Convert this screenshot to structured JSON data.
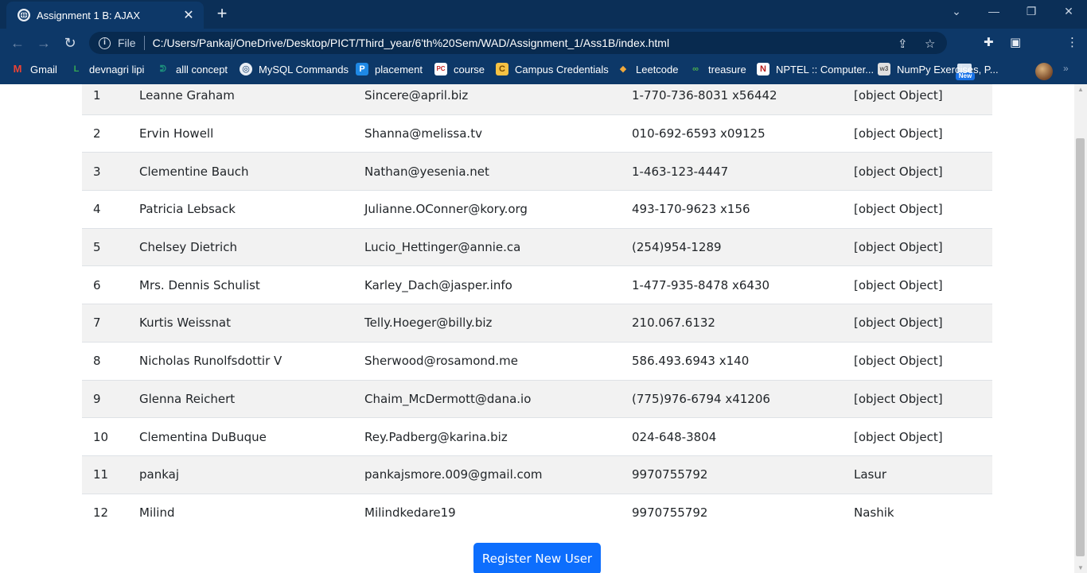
{
  "browser": {
    "tab_title": "Assignment 1 B: AJAX",
    "scheme_label": "File",
    "url": "C:/Users/Pankaj/OneDrive/Desktop/PICT/Third_year/6'th%20Sem/WAD/Assignment_1/Ass1B/index.html",
    "new_badge": "New",
    "bookmarks": [
      {
        "label": "Gmail",
        "icon": "gmail-icon",
        "color": "#ea4335",
        "glyph": "M"
      },
      {
        "label": "devnagri lipi",
        "icon": "bookmark-icon",
        "color": "#34a853",
        "glyph": "L"
      },
      {
        "label": "alll concept",
        "icon": "bookmark-icon",
        "color": "#1c8f7c",
        "glyph": "A"
      },
      {
        "label": "MySQL Commands",
        "icon": "globe-icon",
        "color": "#e9eef5",
        "glyph": "◎"
      },
      {
        "label": "placement",
        "icon": "bookmark-icon",
        "color": "#1e88e5",
        "glyph": "P"
      },
      {
        "label": "course",
        "icon": "bookmark-icon",
        "color": "#c62828",
        "glyph": "PC"
      },
      {
        "label": "Campus Credentials",
        "icon": "bookmark-icon",
        "color": "#f6c244",
        "glyph": "C"
      },
      {
        "label": "Leetcode",
        "icon": "leetcode-icon",
        "color": "#f0a93c",
        "glyph": "◆"
      },
      {
        "label": "treasure",
        "icon": "bookmark-icon",
        "color": "#4caf50",
        "glyph": "∞"
      },
      {
        "label": "NPTEL :: Computer...",
        "icon": "bookmark-icon",
        "color": "#b71c1c",
        "glyph": "N"
      },
      {
        "label": "NumPy Exercises, P...",
        "icon": "bookmark-icon",
        "color": "#8d8d8d",
        "glyph": "w3"
      }
    ]
  },
  "users": [
    {
      "id": "1",
      "name": "Leanne Graham",
      "email": "Sincere@april.biz",
      "phone": "1-770-736-8031 x56442",
      "address": "[object Object]"
    },
    {
      "id": "2",
      "name": "Ervin Howell",
      "email": "Shanna@melissa.tv",
      "phone": "010-692-6593 x09125",
      "address": "[object Object]"
    },
    {
      "id": "3",
      "name": "Clementine Bauch",
      "email": "Nathan@yesenia.net",
      "phone": "1-463-123-4447",
      "address": "[object Object]"
    },
    {
      "id": "4",
      "name": "Patricia Lebsack",
      "email": "Julianne.OConner@kory.org",
      "phone": "493-170-9623 x156",
      "address": "[object Object]"
    },
    {
      "id": "5",
      "name": "Chelsey Dietrich",
      "email": "Lucio_Hettinger@annie.ca",
      "phone": "(254)954-1289",
      "address": "[object Object]"
    },
    {
      "id": "6",
      "name": "Mrs. Dennis Schulist",
      "email": "Karley_Dach@jasper.info",
      "phone": "1-477-935-8478 x6430",
      "address": "[object Object]"
    },
    {
      "id": "7",
      "name": "Kurtis Weissnat",
      "email": "Telly.Hoeger@billy.biz",
      "phone": "210.067.6132",
      "address": "[object Object]"
    },
    {
      "id": "8",
      "name": "Nicholas Runolfsdottir V",
      "email": "Sherwood@rosamond.me",
      "phone": "586.493.6943 x140",
      "address": "[object Object]"
    },
    {
      "id": "9",
      "name": "Glenna Reichert",
      "email": "Chaim_McDermott@dana.io",
      "phone": "(775)976-6794 x41206",
      "address": "[object Object]"
    },
    {
      "id": "10",
      "name": "Clementina DuBuque",
      "email": "Rey.Padberg@karina.biz",
      "phone": "024-648-3804",
      "address": "[object Object]"
    },
    {
      "id": "11",
      "name": "pankaj",
      "email": "pankajsmore.009@gmail.com",
      "phone": "9970755792",
      "address": "Lasur"
    },
    {
      "id": "12",
      "name": "Milind",
      "email": "Milindkedare19",
      "phone": "9970755792",
      "address": "Nashik"
    }
  ],
  "register_button_label": "Register New User",
  "colors": {
    "primary": "#0d6efd",
    "chrome": "#0d3868",
    "stripe": "#f2f2f2"
  }
}
